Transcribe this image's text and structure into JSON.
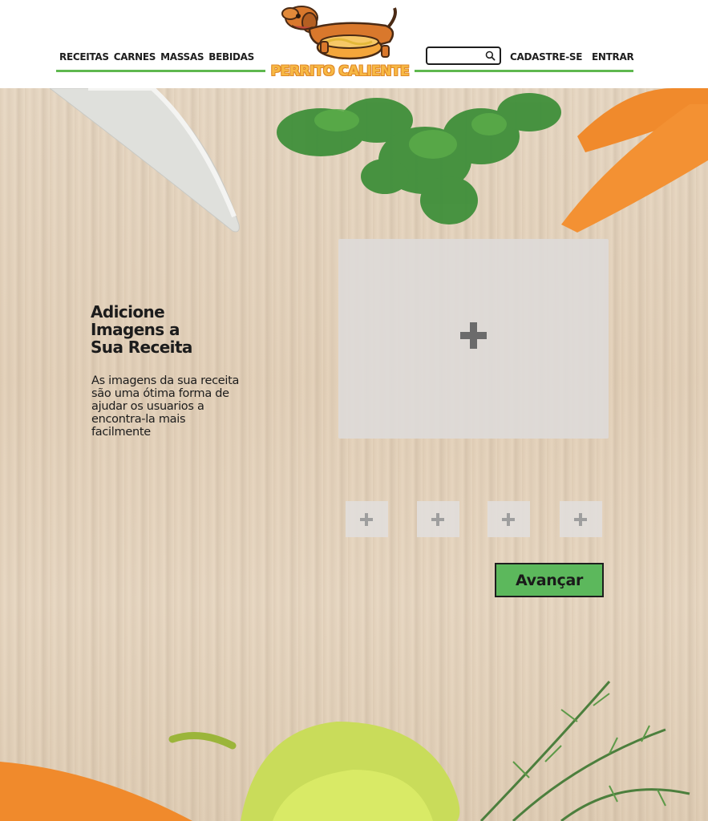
{
  "header": {
    "nav": [
      {
        "label": "RECEITAS"
      },
      {
        "label": "CARNES"
      },
      {
        "label": "MASSAS"
      },
      {
        "label": "BEBIDAS"
      }
    ],
    "logo_text": "PERRITO CALIENTE",
    "search": {
      "value": "",
      "placeholder": ""
    },
    "signup_label": "CADASTRE-SE",
    "login_label": "ENTRAR"
  },
  "main": {
    "title": "Adicione\nImagens a\nSua Receita",
    "description": "As imagens da sua receita são uma ótima forma de ajudar os usuarios a encontra-la mais facilmente",
    "thumbnails_count": 4,
    "next_button": "Avançar"
  },
  "colors": {
    "accent_green": "#5cb85c",
    "logo_orange": "#f7b944",
    "text_dark": "#1c1c1c"
  },
  "icons": {
    "search": "search-icon",
    "add": "plus-icon",
    "logo": "dachshund-hotdog-logo"
  }
}
